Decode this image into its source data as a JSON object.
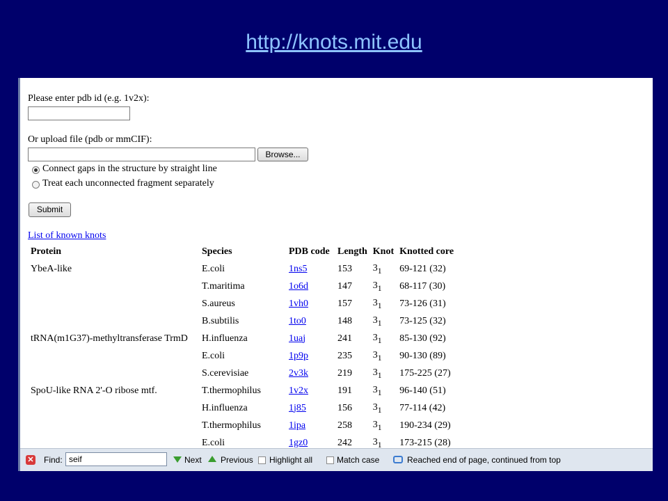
{
  "slide": {
    "url": "http://knots.mit.edu"
  },
  "form": {
    "pdb_label": "Please enter pdb id (e.g. 1v2x):",
    "pdb_value": "",
    "upload_label": "Or upload file (pdb or mmCIF):",
    "file_value": "",
    "browse_label": "Browse...",
    "radio_connect": "Connect gaps in the structure by straight line",
    "radio_separate": "Treat each unconnected fragment separately",
    "submit_label": "Submit",
    "known_link": "List of known knots"
  },
  "table": {
    "headers": [
      "Protein",
      "Species",
      "PDB code",
      "Length",
      "Knot",
      "Knotted core"
    ],
    "rows": [
      {
        "protein": "YbeA-like",
        "species": "E.coli",
        "pdb": "1ns5",
        "length": "153",
        "knot": "3",
        "sub": "1",
        "core": "69-121 (32)"
      },
      {
        "protein": "",
        "species": "T.maritima",
        "pdb": "1o6d",
        "length": "147",
        "knot": "3",
        "sub": "1",
        "core": "68-117 (30)"
      },
      {
        "protein": "",
        "species": "S.aureus",
        "pdb": "1vh0",
        "length": "157",
        "knot": "3",
        "sub": "1",
        "core": "73-126 (31)"
      },
      {
        "protein": "",
        "species": "B.subtilis",
        "pdb": "1to0",
        "length": "148",
        "knot": "3",
        "sub": "1",
        "core": "73-125 (32)"
      },
      {
        "protein": "tRNA(m1G37)-methyltransferase TrmD",
        "species": "H.influenza",
        "pdb": "1uaj",
        "length": "241",
        "knot": "3",
        "sub": "1",
        "core": "85-130 (92)"
      },
      {
        "protein": "",
        "species": "E.coli",
        "pdb": "1p9p",
        "length": "235",
        "knot": "3",
        "sub": "1",
        "core": "90-130 (89)"
      },
      {
        "protein": "",
        "species": "S.cerevisiae",
        "pdb": "2v3k",
        "length": "219",
        "knot": "3",
        "sub": "1",
        "core": "175-225 (27)"
      },
      {
        "protein": "SpoU-like RNA 2'-O ribose mtf.",
        "species": "T.thermophilus",
        "pdb": "1v2x",
        "length": "191",
        "knot": "3",
        "sub": "1",
        "core": "96-140 (51)"
      },
      {
        "protein": "",
        "species": "H.influenza",
        "pdb": "1j85",
        "length": "156",
        "knot": "3",
        "sub": "1",
        "core": "77-114 (42)"
      },
      {
        "protein": "",
        "species": "T.thermophilus",
        "pdb": "1ipa",
        "length": "258",
        "knot": "3",
        "sub": "1",
        "core": "190-234 (29)"
      },
      {
        "protein": "",
        "species": "E.coli",
        "pdb": "1gz0",
        "length": "242",
        "knot": "3",
        "sub": "1",
        "core": "173-215 (28)"
      }
    ]
  },
  "findbar": {
    "find_label": "Find:",
    "find_value": "seif",
    "next_label": "Next",
    "previous_label": "Previous",
    "highlight_label": "Highlight all",
    "matchcase_label": "Match case",
    "status": "Reached end of page, continued from top"
  }
}
